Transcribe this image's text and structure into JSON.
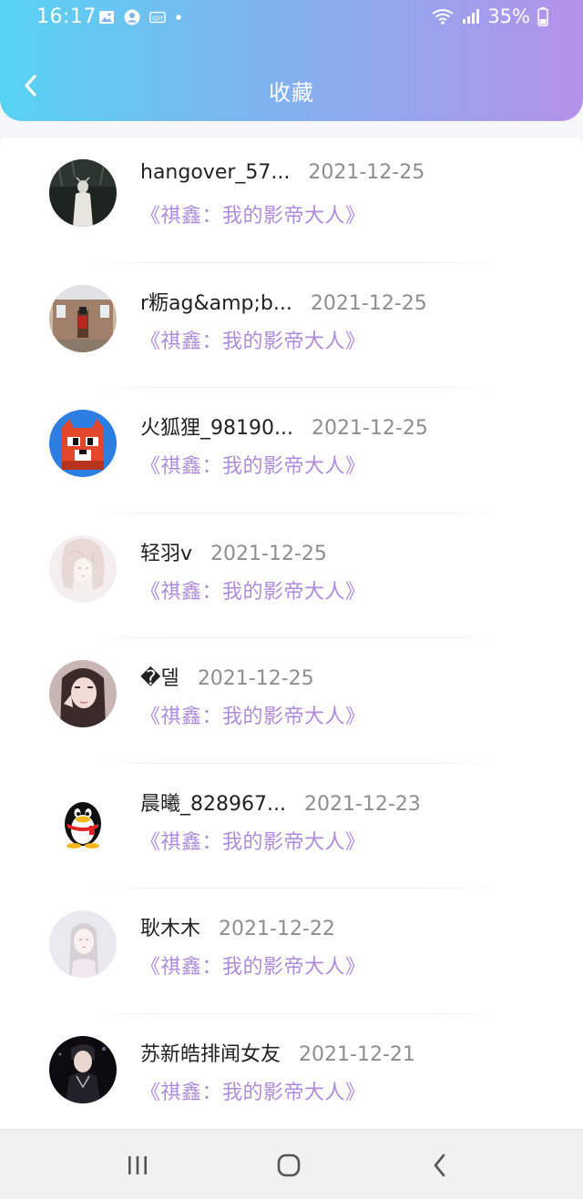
{
  "status_bar": {
    "time": "16:17",
    "battery": "35%"
  },
  "header": {
    "title": "收藏"
  },
  "items": [
    {
      "name": "hangover_57...",
      "date": "2021-12-25",
      "novel": "《祺鑫：我的影帝大人》",
      "avatar": "dark-figure"
    },
    {
      "name": "r粝ag&amp;b...",
      "date": "2021-12-25",
      "novel": "《祺鑫：我的影帝大人》",
      "avatar": "guard-photo"
    },
    {
      "name": "火狐狸_98190...",
      "date": "2021-12-25",
      "novel": "《祺鑫：我的影帝大人》",
      "avatar": "pixel-fox"
    },
    {
      "name": "轻羽v",
      "date": "2021-12-25",
      "novel": "《祺鑫：我的影帝大人》",
      "avatar": "sketch-girl"
    },
    {
      "name": "�델",
      "date": "2021-12-25",
      "novel": "《祺鑫：我的影帝大人》",
      "avatar": "girl-photo"
    },
    {
      "name": "晨曦_828967...",
      "date": "2021-12-23",
      "novel": "《祺鑫：我的影帝大人》",
      "avatar": "qq-penguin"
    },
    {
      "name": "耿木木",
      "date": "2021-12-22",
      "novel": "《祺鑫：我的影帝大人》",
      "avatar": "watercolor-girl"
    },
    {
      "name": "苏新皓排闻女友",
      "date": "2021-12-21",
      "novel": "《祺鑫：我的影帝大人》",
      "avatar": "dark-portrait"
    }
  ],
  "colors": {
    "header_gradient_start": "#57d3f3",
    "header_gradient_end": "#b492ea",
    "novel_text": "#ae8bd8",
    "date_text": "#8e8e8e"
  }
}
